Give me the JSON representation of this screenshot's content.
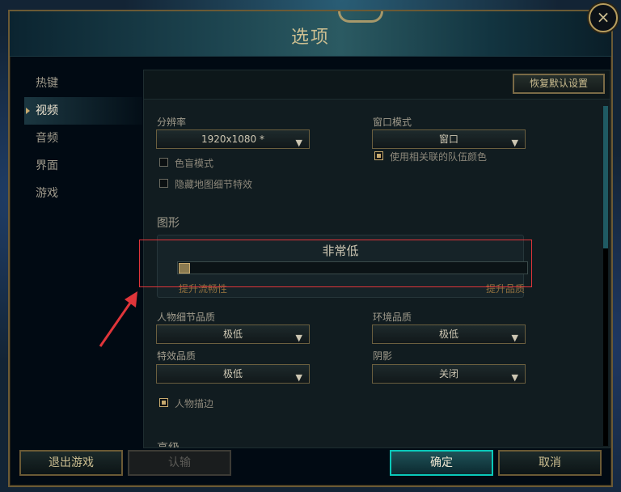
{
  "window": {
    "title": "选项",
    "close_icon": "×"
  },
  "sidebar": {
    "items": [
      {
        "label": "热键",
        "active": false
      },
      {
        "label": "视频",
        "active": true
      },
      {
        "label": "音频",
        "active": false
      },
      {
        "label": "界面",
        "active": false
      },
      {
        "label": "游戏",
        "active": false
      }
    ]
  },
  "toolbar": {
    "restore_label": "恢复默认设置"
  },
  "resolution": {
    "label": "分辨率",
    "value": "1920x1080 *"
  },
  "window_mode": {
    "label": "窗口模式",
    "value": "窗口"
  },
  "checkboxes": {
    "colorblind": {
      "label": "色盲模式",
      "checked": false
    },
    "hide_map_detail": {
      "label": "隐藏地图细节特效",
      "checked": false
    },
    "team_color": {
      "label": "使用相关联的队伍颜色",
      "checked": true
    },
    "character_outline": {
      "label": "人物描边",
      "checked": true
    }
  },
  "graphics": {
    "section_title": "图形",
    "preset_label": "非常低",
    "slider_level": 0.0,
    "left_label": "提升流畅性",
    "right_label": "提升品质"
  },
  "quality": {
    "character": {
      "label": "人物细节品质",
      "value": "极低"
    },
    "environment": {
      "label": "环境品质",
      "value": "极低"
    },
    "effects": {
      "label": "特效品质",
      "value": "极低"
    },
    "shadows": {
      "label": "阴影",
      "value": "关闭"
    }
  },
  "advanced": {
    "section_title": "高级"
  },
  "footer": {
    "exit_label": "退出游戏",
    "surrender_label": "认输",
    "confirm_label": "确定",
    "cancel_label": "取消"
  },
  "colors": {
    "gold": "#c8aa6e",
    "text": "#a09b8c",
    "highlight_red": "#e0353a",
    "primary_teal": "#0ac8b9"
  }
}
